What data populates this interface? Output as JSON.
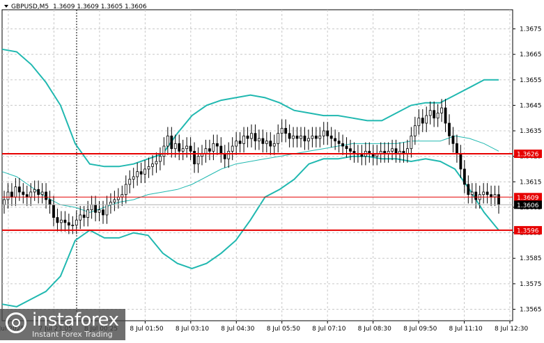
{
  "chart_data": {
    "type": "candlestick",
    "symbol": "GBPUSD,M5",
    "ohlc_header": "1.3609 1.3609 1.3605 1.3606",
    "ylim": [
      1.35605,
      1.36825
    ],
    "y_ticks": [
      "1.3675",
      "1.3665",
      "1.3655",
      "1.3645",
      "1.3635",
      "1.3625",
      "1.3615",
      "1.3605",
      "1.3595",
      "1.3585",
      "1.3575",
      "1.3565"
    ],
    "x_ticks": [
      "7 Jul 2025",
      "7 Jul 23:05",
      "8 Jul 00:25",
      "8 Jul 01:50",
      "8 Jul 03:10",
      "8 Jul 04:30",
      "8 Jul 05:50",
      "8 Jul 07:10",
      "8 Jul 08:30",
      "8 Jul 09:50",
      "8 Jul 11:10",
      "8 Jul 12:30"
    ],
    "horizontal_levels": [
      {
        "label": "1.3626",
        "value": 1.3626,
        "style": "solid",
        "color": "#e60000"
      },
      {
        "label": "1.3596",
        "value": 1.3596,
        "style": "solid",
        "color": "#e60000"
      },
      {
        "label": "1.3609",
        "value": 1.3609,
        "style": "thin",
        "color": "#e60000"
      }
    ],
    "current_price": {
      "label": "1.3606",
      "value": 1.3606
    },
    "candles_close": [
      1.3608,
      1.3611,
      1.3609,
      1.3613,
      1.3611,
      1.361,
      1.3609,
      1.3611,
      1.3612,
      1.361,
      1.3611,
      1.3608,
      1.3606,
      1.3601,
      1.3599,
      1.36,
      1.3599,
      1.3598,
      1.3598,
      1.36,
      1.3602,
      1.3601,
      1.3604,
      1.3606,
      1.3603,
      1.3604,
      1.3602,
      1.3606,
      1.3607,
      1.3608,
      1.3609,
      1.361,
      1.3614,
      1.3616,
      1.3617,
      1.3619,
      1.3618,
      1.362,
      1.3621,
      1.3622,
      1.3623,
      1.3625,
      1.3629,
      1.3633,
      1.3628,
      1.363,
      1.3627,
      1.3628,
      1.3629,
      1.3627,
      1.3622,
      1.3625,
      1.3626,
      1.3628,
      1.3627,
      1.363,
      1.3629,
      1.3626,
      1.3624,
      1.3627,
      1.3629,
      1.3631,
      1.363,
      1.3633,
      1.3632,
      1.3634,
      1.3631,
      1.3632,
      1.363,
      1.3631,
      1.3629,
      1.363,
      1.3634,
      1.3636,
      1.3634,
      1.3632,
      1.3633,
      1.3632,
      1.3633,
      1.3631,
      1.3632,
      1.3633,
      1.3632,
      1.3633,
      1.3635,
      1.3633,
      1.3632,
      1.3631,
      1.363,
      1.3629,
      1.3628,
      1.3627,
      1.3626,
      1.3626,
      1.3625,
      1.3627,
      1.3626,
      1.3625,
      1.3626,
      1.3627,
      1.3626,
      1.3627,
      1.3628,
      1.3626,
      1.3627,
      1.3626,
      1.3628,
      1.3633,
      1.3637,
      1.364,
      1.3638,
      1.3641,
      1.3643,
      1.364,
      1.3642,
      1.3644,
      1.3638,
      1.3633,
      1.363,
      1.3626,
      1.362,
      1.3614,
      1.361,
      1.3611,
      1.3608,
      1.361,
      1.3611,
      1.361,
      1.3609,
      1.361,
      1.3606
    ],
    "bollinger_upper": [
      1.3667,
      1.3666,
      1.3661,
      1.3654,
      1.3645,
      1.363,
      1.3622,
      1.3621,
      1.3621,
      1.3622,
      1.3624,
      1.3626,
      1.3634,
      1.3641,
      1.3645,
      1.3647,
      1.3648,
      1.3649,
      1.3648,
      1.3646,
      1.3643,
      1.3642,
      1.3641,
      1.3641,
      1.364,
      1.3639,
      1.3639,
      1.3642,
      1.3645,
      1.3646,
      1.3646,
      1.3649,
      1.3652,
      1.3655,
      1.3655
    ],
    "bollinger_middle": [
      1.3619,
      1.3617,
      1.3613,
      1.3609,
      1.3606,
      1.3605,
      1.3603,
      1.3605,
      1.3607,
      1.3608,
      1.361,
      1.3611,
      1.3612,
      1.3614,
      1.3617,
      1.362,
      1.3622,
      1.3623,
      1.3624,
      1.3625,
      1.3626,
      1.3627,
      1.3628,
      1.3629,
      1.363,
      1.363,
      1.363,
      1.363,
      1.3631,
      1.3631,
      1.3631,
      1.3633,
      1.3632,
      1.363,
      1.3627
    ],
    "bollinger_lower": [
      1.3567,
      1.3566,
      1.3569,
      1.3572,
      1.3578,
      1.3592,
      1.3596,
      1.3593,
      1.3593,
      1.3595,
      1.3594,
      1.3587,
      1.3583,
      1.3581,
      1.3583,
      1.3587,
      1.3592,
      1.36,
      1.3609,
      1.3612,
      1.3616,
      1.3622,
      1.3624,
      1.3624,
      1.3625,
      1.3625,
      1.3624,
      1.3624,
      1.3623,
      1.3624,
      1.3623,
      1.362,
      1.3612,
      1.3603,
      1.3596
    ]
  },
  "logo": {
    "name": "instaforex",
    "tagline": "Instant Forex Trading"
  },
  "colors": {
    "grid": "#c8c8c8",
    "band": "#20b8b0",
    "candle": "#000000",
    "level": "#e60000",
    "cursor": "#000000"
  }
}
